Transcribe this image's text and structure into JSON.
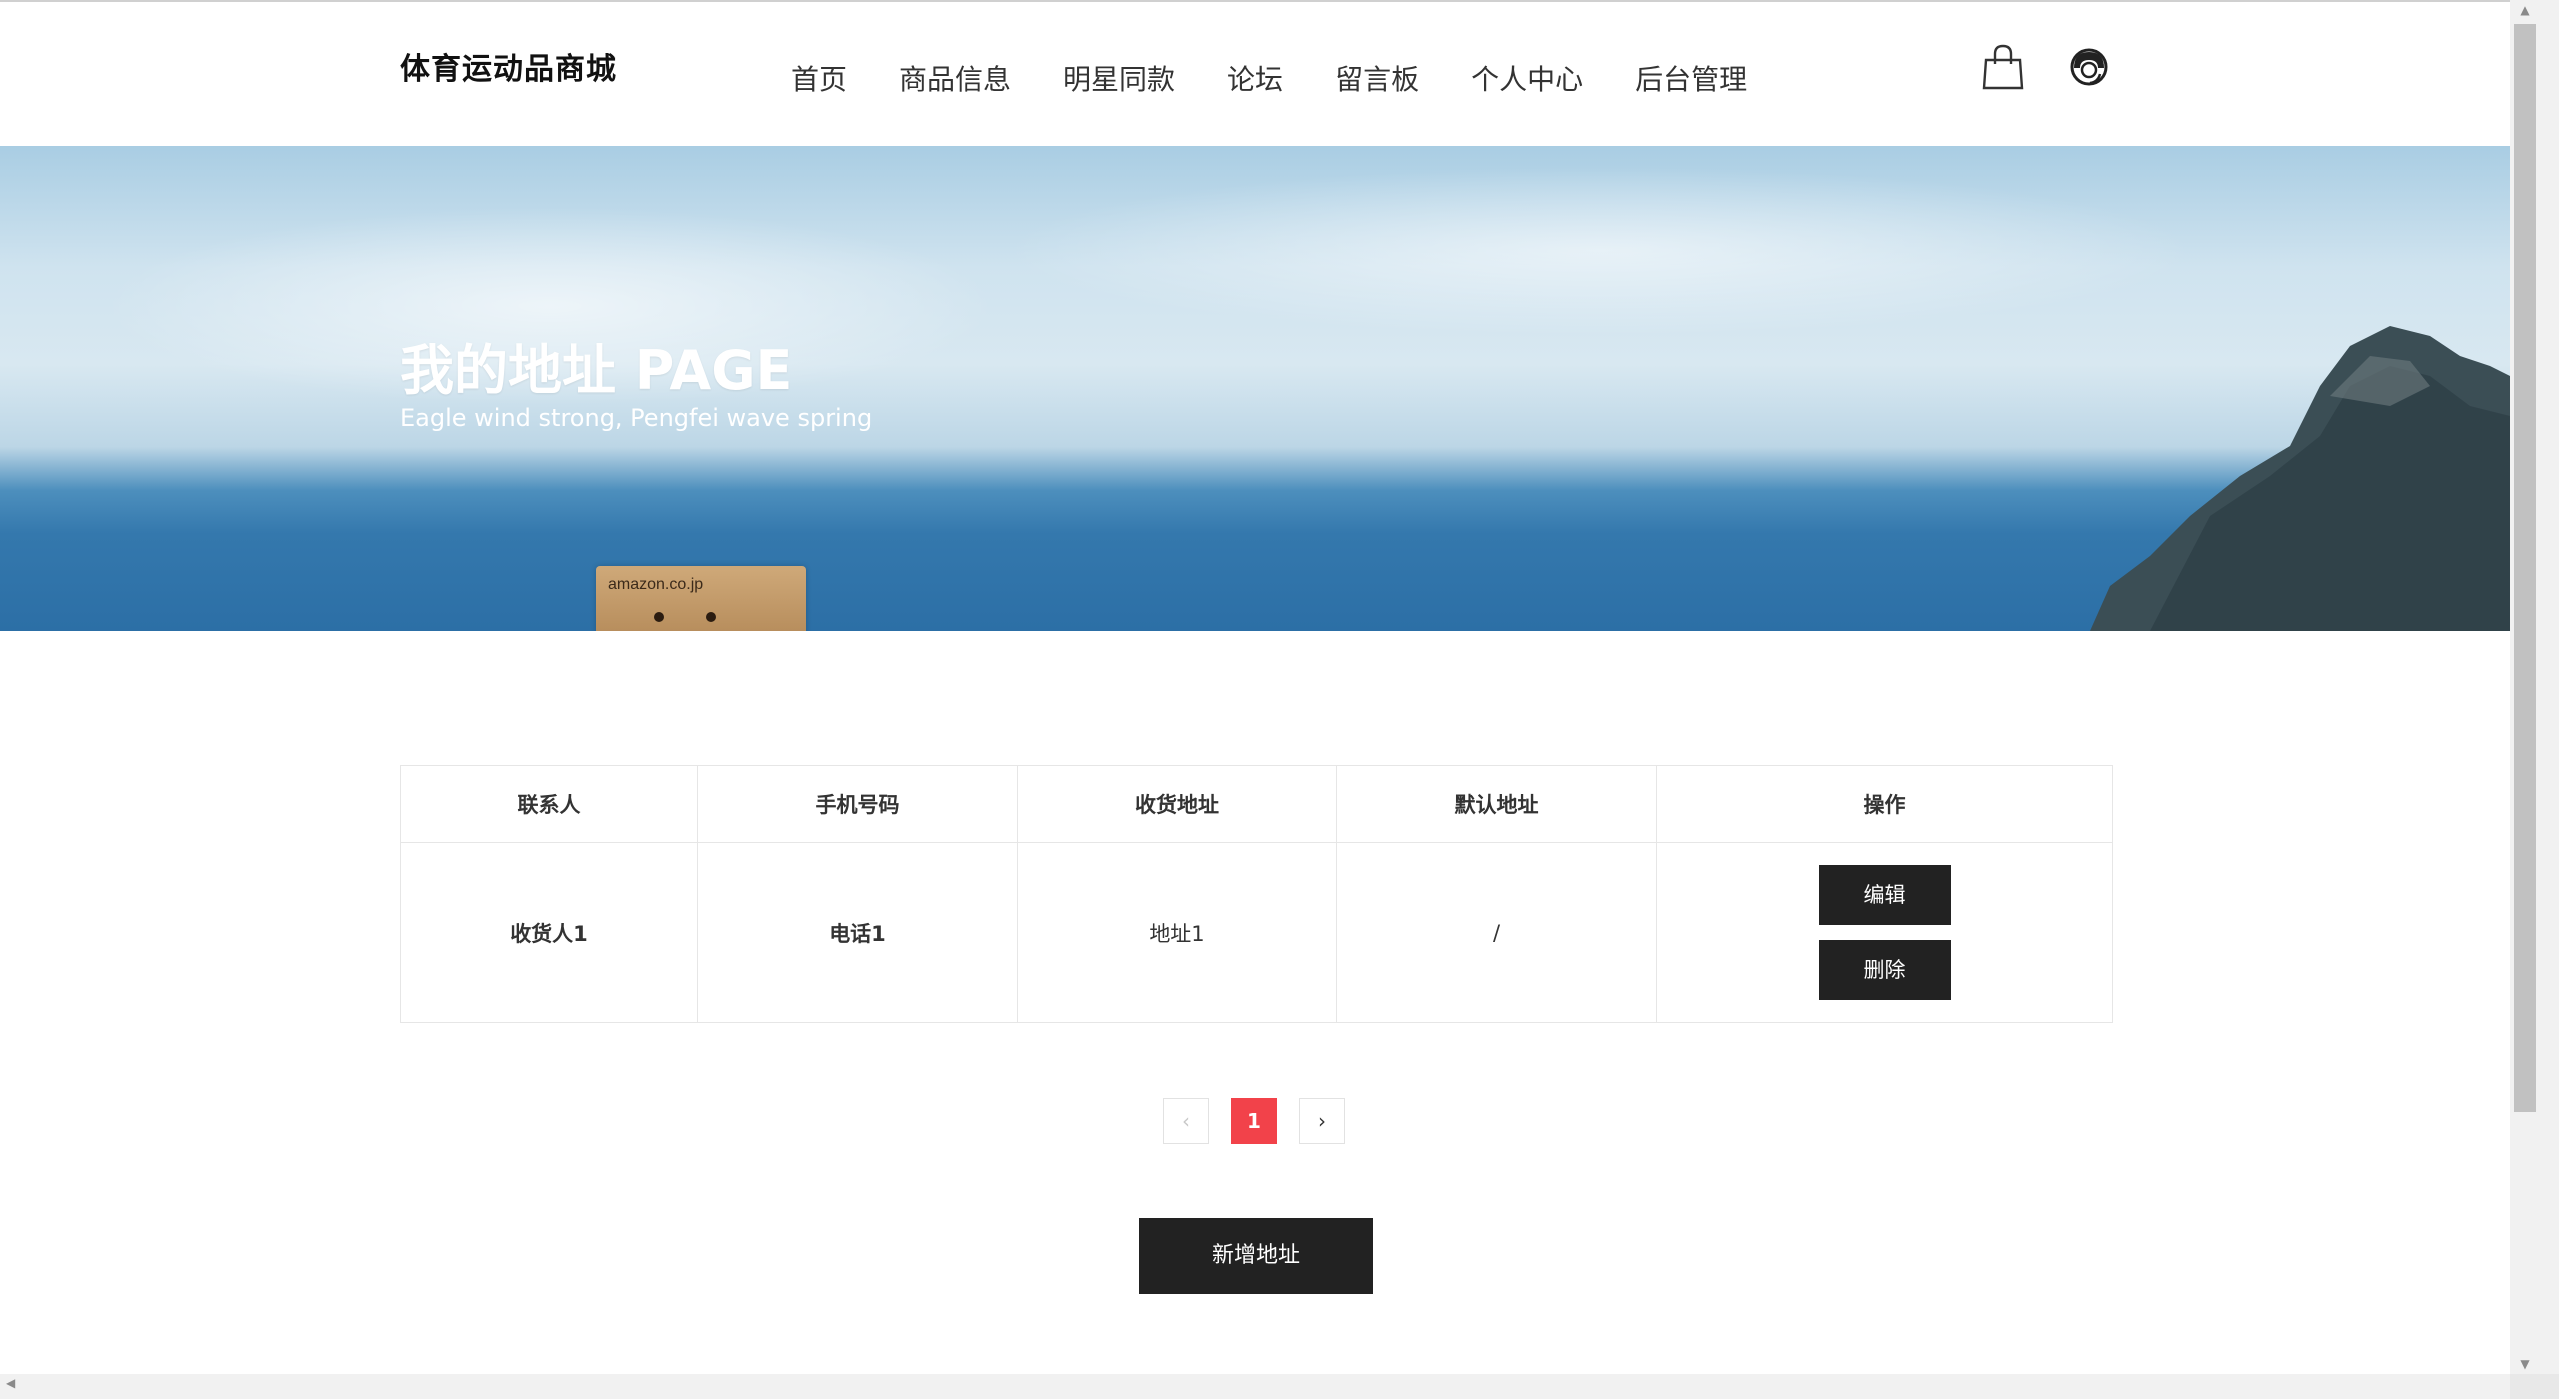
{
  "header": {
    "brand": "体育运动品商城",
    "nav": [
      "首页",
      "商品信息",
      "明星同款",
      "论坛",
      "留言板",
      "个人中心",
      "后台管理"
    ],
    "icons": [
      "shopping-bag-icon",
      "customer-service-icon"
    ]
  },
  "hero": {
    "title": "我的地址 PAGE",
    "subtitle": "Eagle wind strong, Pengfei wave spring",
    "box_text": "amazon.co.jp"
  },
  "table": {
    "headers": [
      "联系人",
      "手机号码",
      "收货地址",
      "默认地址",
      "操作"
    ],
    "rows": [
      {
        "contact": "收货人1",
        "phone": "电话1",
        "address": "地址1",
        "default": "/",
        "edit_label": "编辑",
        "delete_label": "删除"
      }
    ]
  },
  "pagination": {
    "prev": "‹",
    "current": "1",
    "next": "›"
  },
  "add_button": "新增地址",
  "colors": {
    "accent_red": "#f2424a",
    "button_dark": "#222222"
  }
}
